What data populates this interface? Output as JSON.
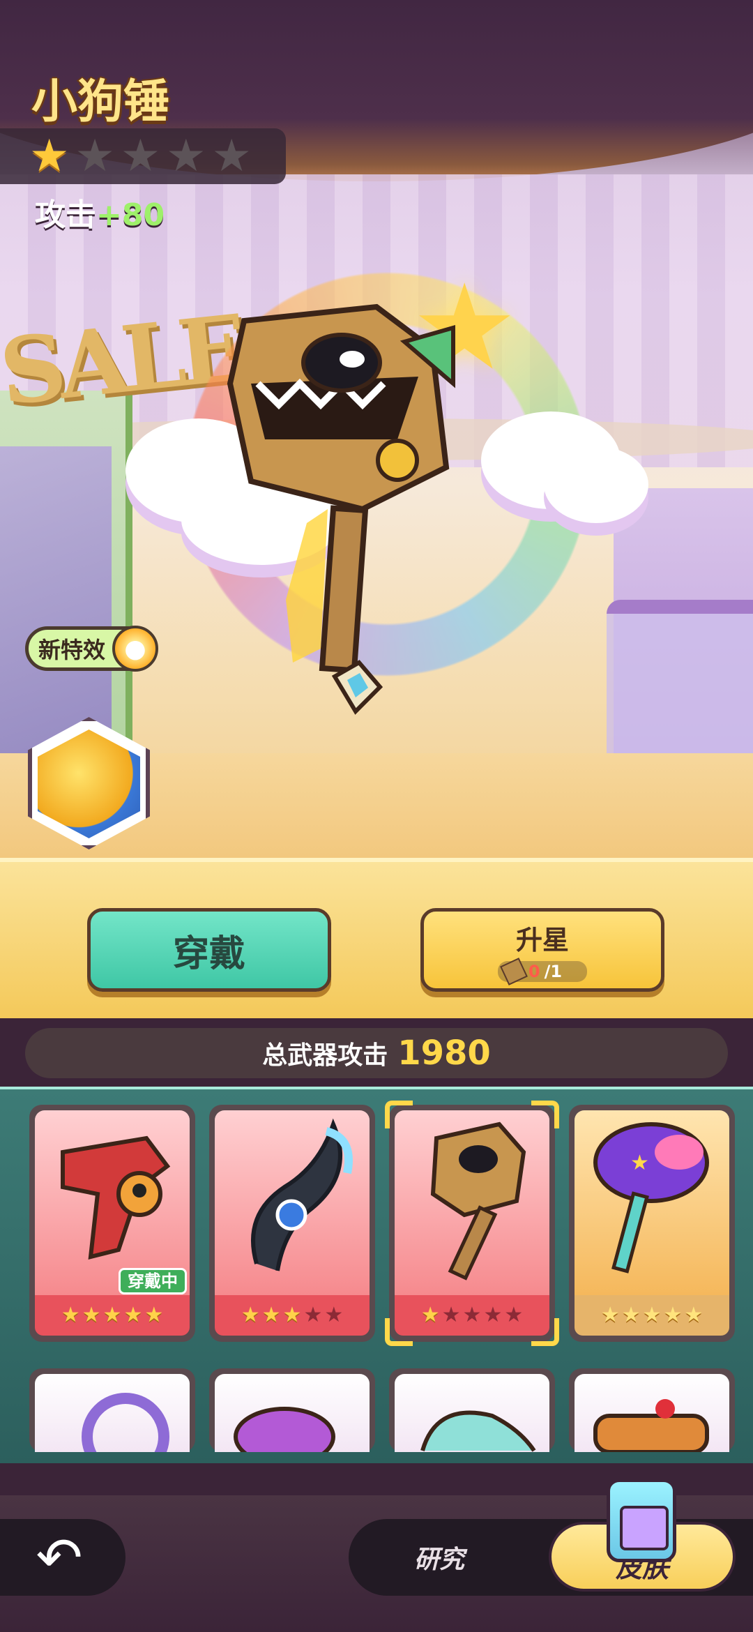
{
  "weapon": {
    "name": "小狗锤",
    "stars_total": 5,
    "stars_filled": 1,
    "attack_label": "攻击",
    "attack_bonus": "+80"
  },
  "badges": {
    "new_effect": "新特效"
  },
  "actions": {
    "wear_label": "穿戴",
    "upgrade_label": "升星",
    "upgrade_have": "0",
    "upgrade_need": "/1"
  },
  "total": {
    "label": "总武器攻击",
    "value": "1980"
  },
  "cards": [
    {
      "name": "red-gun",
      "stars": 5,
      "filled": 5,
      "tag": "穿戴中",
      "rarity": "red"
    },
    {
      "name": "wing-scythe",
      "stars": 5,
      "filled": 3,
      "tag": "",
      "rarity": "red"
    },
    {
      "name": "dog-hammer",
      "stars": 5,
      "filled": 1,
      "tag": "",
      "rarity": "red",
      "selected": true
    },
    {
      "name": "galaxy-hammer",
      "stars": 5,
      "filled": 5,
      "tag": "",
      "rarity": "gold"
    }
  ],
  "nav": {
    "research": "研究",
    "skin": "皮肤"
  },
  "colors": {
    "accent_gold": "#ffd84a",
    "wear_green": "#3fc7a5",
    "bonus_green": "#9ef06a"
  }
}
